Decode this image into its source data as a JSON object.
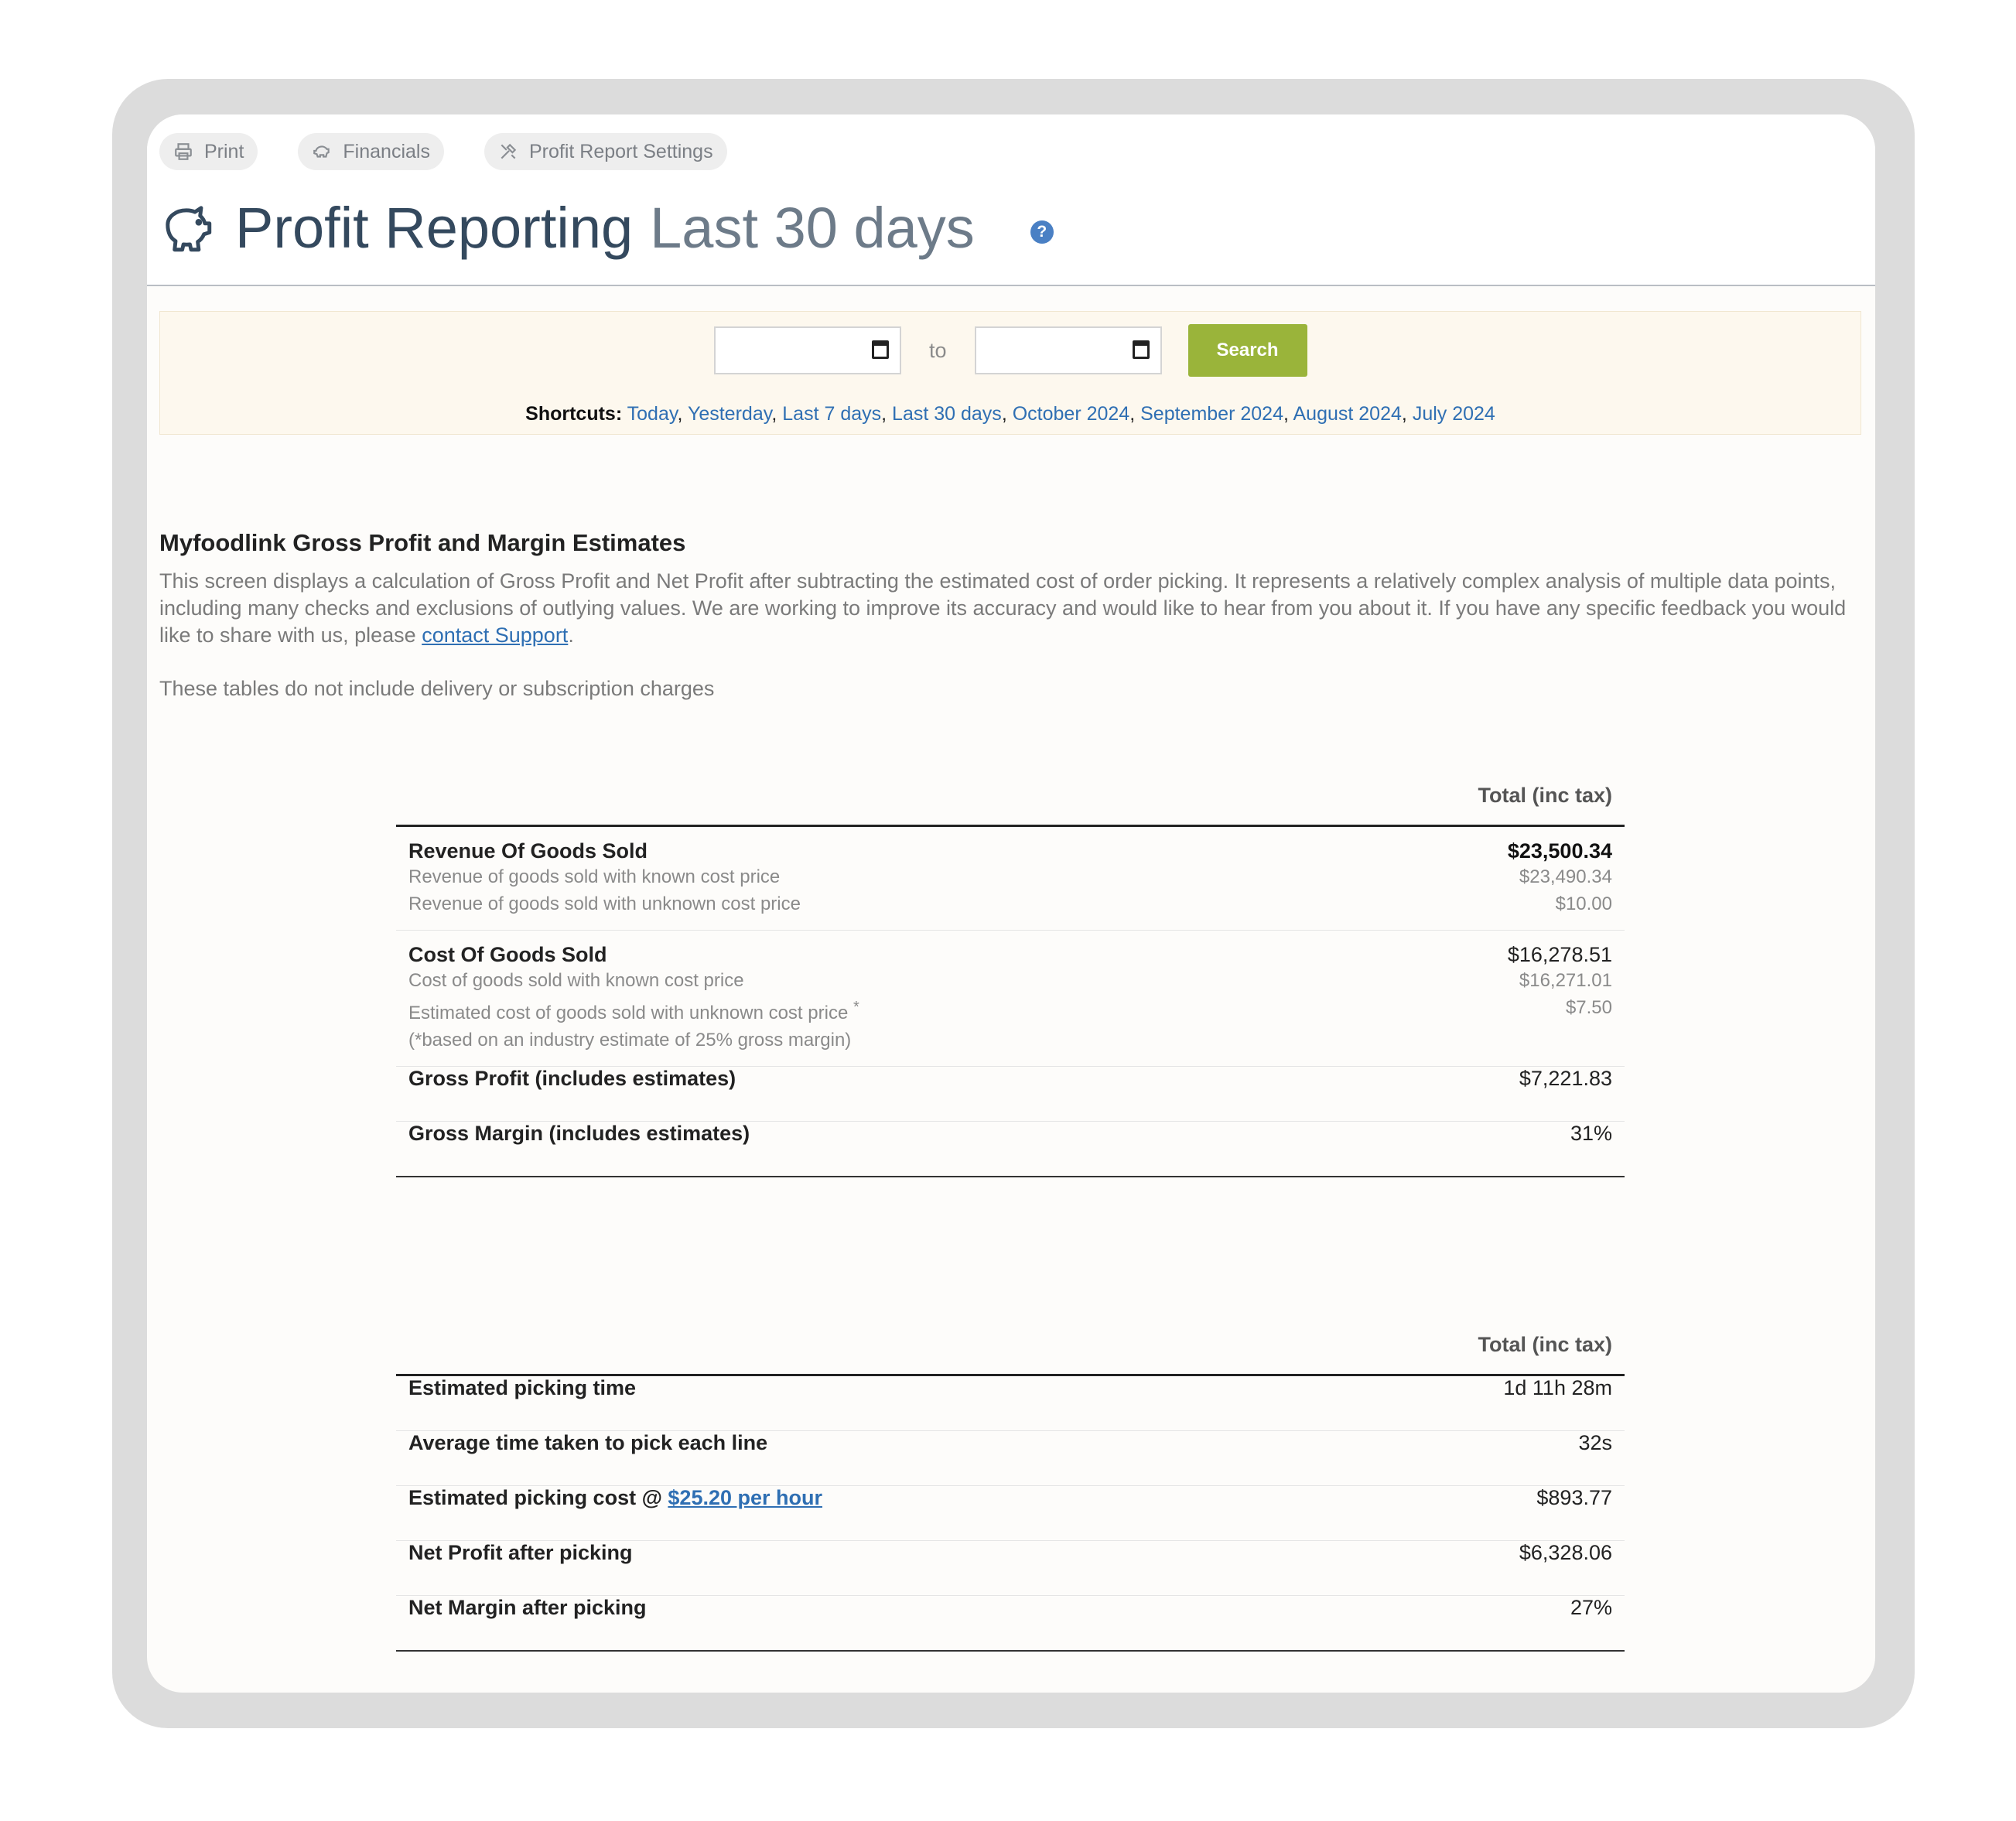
{
  "toolbar": {
    "print_label": "Print",
    "financials_label": "Financials",
    "settings_label": "Profit Report Settings"
  },
  "header": {
    "title": "Profit Reporting",
    "period": "Last 30 days",
    "help_glyph": "?"
  },
  "date_filter": {
    "separator": "to",
    "search_label": "Search",
    "shortcuts_label": "Shortcuts:",
    "shortcuts": [
      "Today",
      "Yesterday",
      "Last 7 days",
      "Last 30 days",
      "October 2024",
      "September 2024",
      "August 2024",
      "July 2024"
    ]
  },
  "intro": {
    "heading": "Myfoodlink Gross Profit and Margin Estimates",
    "body": "This screen displays a calculation of Gross Profit and Net Profit after subtracting the estimated cost of order picking. It represents a relatively complex analysis of multiple data points, including many checks and exclusions of outlying values. We are working to improve its accuracy and would like to hear from you about it. If you have any specific feedback you would like to share with us, please ",
    "link": "contact Support",
    "body_end": ".",
    "note": "These tables do not include delivery or subscription charges"
  },
  "gross_table": {
    "column_header": "Total (inc tax)",
    "revenue": {
      "label": "Revenue Of Goods Sold",
      "value": "$23,500.34",
      "known_label": "Revenue of goods sold with known cost price",
      "known_value": "$23,490.34",
      "unknown_label": "Revenue of goods sold with unknown cost price",
      "unknown_value": "$10.00"
    },
    "cost": {
      "label": "Cost Of Goods Sold",
      "value": "$16,278.51",
      "known_label": "Cost of goods sold with known cost price",
      "known_value": "$16,271.01",
      "estimated_label": "Estimated cost of goods sold with unknown cost price",
      "estimated_marker": "*",
      "estimated_value": "$7.50",
      "footnote": "(*based on an industry estimate of 25% gross margin)"
    },
    "gross_profit": {
      "label": "Gross Profit (includes estimates)",
      "value": "$7,221.83"
    },
    "gross_margin": {
      "label": "Gross Margin (includes estimates)",
      "value": "31%"
    }
  },
  "net_table": {
    "column_header": "Total (inc tax)",
    "picking_time": {
      "label": "Estimated picking time",
      "value": "1d 11h 28m"
    },
    "avg_time": {
      "label": "Average time taken to pick each line",
      "value": "32s"
    },
    "picking_cost": {
      "label": "Estimated picking cost @ ",
      "rate": "$25.20 per hour",
      "value": "$893.77"
    },
    "net_profit": {
      "label": "Net Profit after picking",
      "value": "$6,328.06"
    },
    "net_margin": {
      "label": "Net Margin after picking",
      "value": "27%"
    }
  },
  "colors": {
    "accent_button": "#9ab43a",
    "link": "#2f6fb3",
    "title": "#34495e",
    "help_badge": "#4a80c4",
    "filter_background": "#fdf8ee"
  },
  "icons": [
    "printer-icon",
    "piggy-bank-icon",
    "tools-icon",
    "calendar-icon",
    "help-icon"
  ]
}
